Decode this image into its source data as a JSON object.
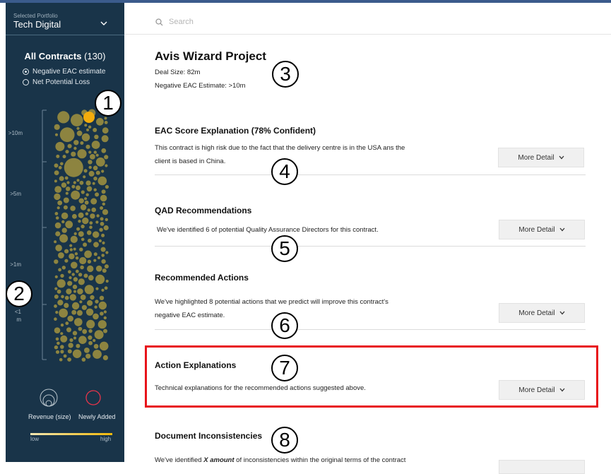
{
  "sidebar": {
    "portfolio_label": "Selected Portfolio",
    "portfolio_value": "Tech Digital",
    "contracts_title": "All Contracts",
    "contracts_count": "(130)",
    "radio_options": [
      {
        "label": "Negative EAC estimate",
        "selected": true
      },
      {
        "label": "Net Potential Loss",
        "selected": false
      }
    ],
    "ticks": [
      ">10m",
      ">5m",
      ">1m",
      "<1",
      "m"
    ],
    "legend_revenue": "Revenue (size)",
    "legend_new": "Newly Added",
    "scale_low": "low",
    "scale_high": "high",
    "colors": {
      "bubble": "#8d8440",
      "highlight": "#f3ac0c",
      "new_ring": "#e8344a"
    }
  },
  "search": {
    "placeholder": "Search"
  },
  "project": {
    "title": "Avis Wizard Project",
    "deal_size": "Deal Size: 82m",
    "eac_estimate": "Negative EAC Estimate: >10m"
  },
  "sections": [
    {
      "title": "EAC Score Explanation (78% Confident)",
      "desc_line1": "This contract is high risk due to the fact that the delivery centre is in the USA ans the",
      "desc_line2": "client is based in China.",
      "button": "More Detail"
    },
    {
      "title": "QAD Recommendations",
      "desc_line1": "We've identified 6 of potential Quality Assurance Directors for this contract.",
      "button": "More Detail"
    },
    {
      "title": "Recommended Actions",
      "desc_line1": "We've highlighted 8 potential actions that we predict will improve this contract's",
      "desc_line2": "negative EAC estimate.",
      "button": "More Detail"
    },
    {
      "title": "Action Explanations",
      "desc_line1": "Technical explanations for the recommended actions suggested above.",
      "button": "More Detail"
    },
    {
      "title": "Document Inconsistencies",
      "desc_pre": "We've identified ",
      "desc_em": "X amount",
      "desc_post": " of inconsistencies within the original terms of the contract"
    }
  ],
  "annotations": [
    "1",
    "2",
    "3",
    "4",
    "5",
    "6",
    "7",
    "8"
  ]
}
